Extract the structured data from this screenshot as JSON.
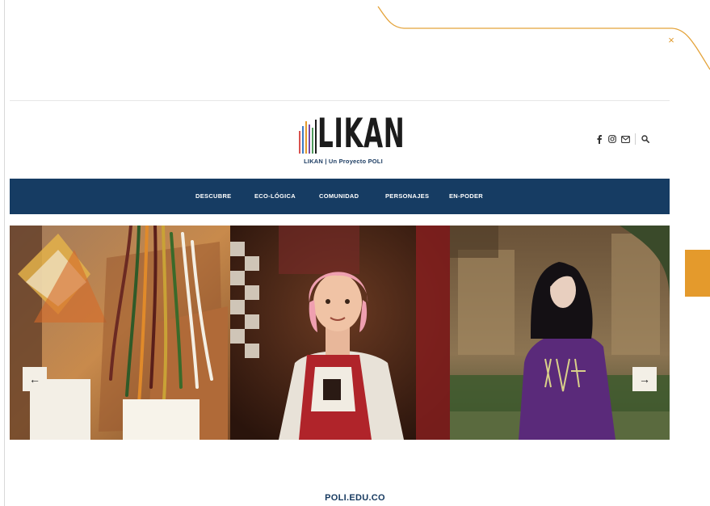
{
  "header": {
    "logo_text": "LIKAN",
    "tagline": "LIKAN | Un Proyecto POLI",
    "social_icons": [
      "facebook-icon",
      "instagram-icon",
      "mail-icon",
      "search-icon"
    ]
  },
  "nav": {
    "items": [
      {
        "label": "DESCUBRE"
      },
      {
        "label": "ECO-LÓGICA"
      },
      {
        "label": "COMUNIDAD"
      },
      {
        "label": "PERSONAJES"
      },
      {
        "label": "EN-PODER"
      }
    ]
  },
  "slider": {
    "prev_glyph": "←",
    "next_glyph": "→",
    "slides": [
      "woven-textiles-photo",
      "woman-pink-hair-portrait",
      "person-purple-sweater-photo"
    ]
  },
  "close_glyph": "×",
  "footer": {
    "link_text": "POLI.EDU.CO"
  },
  "colors": {
    "nav_background": "#163c63",
    "accent_orange": "#e49a2c",
    "brand_text": "#1d3d63"
  }
}
